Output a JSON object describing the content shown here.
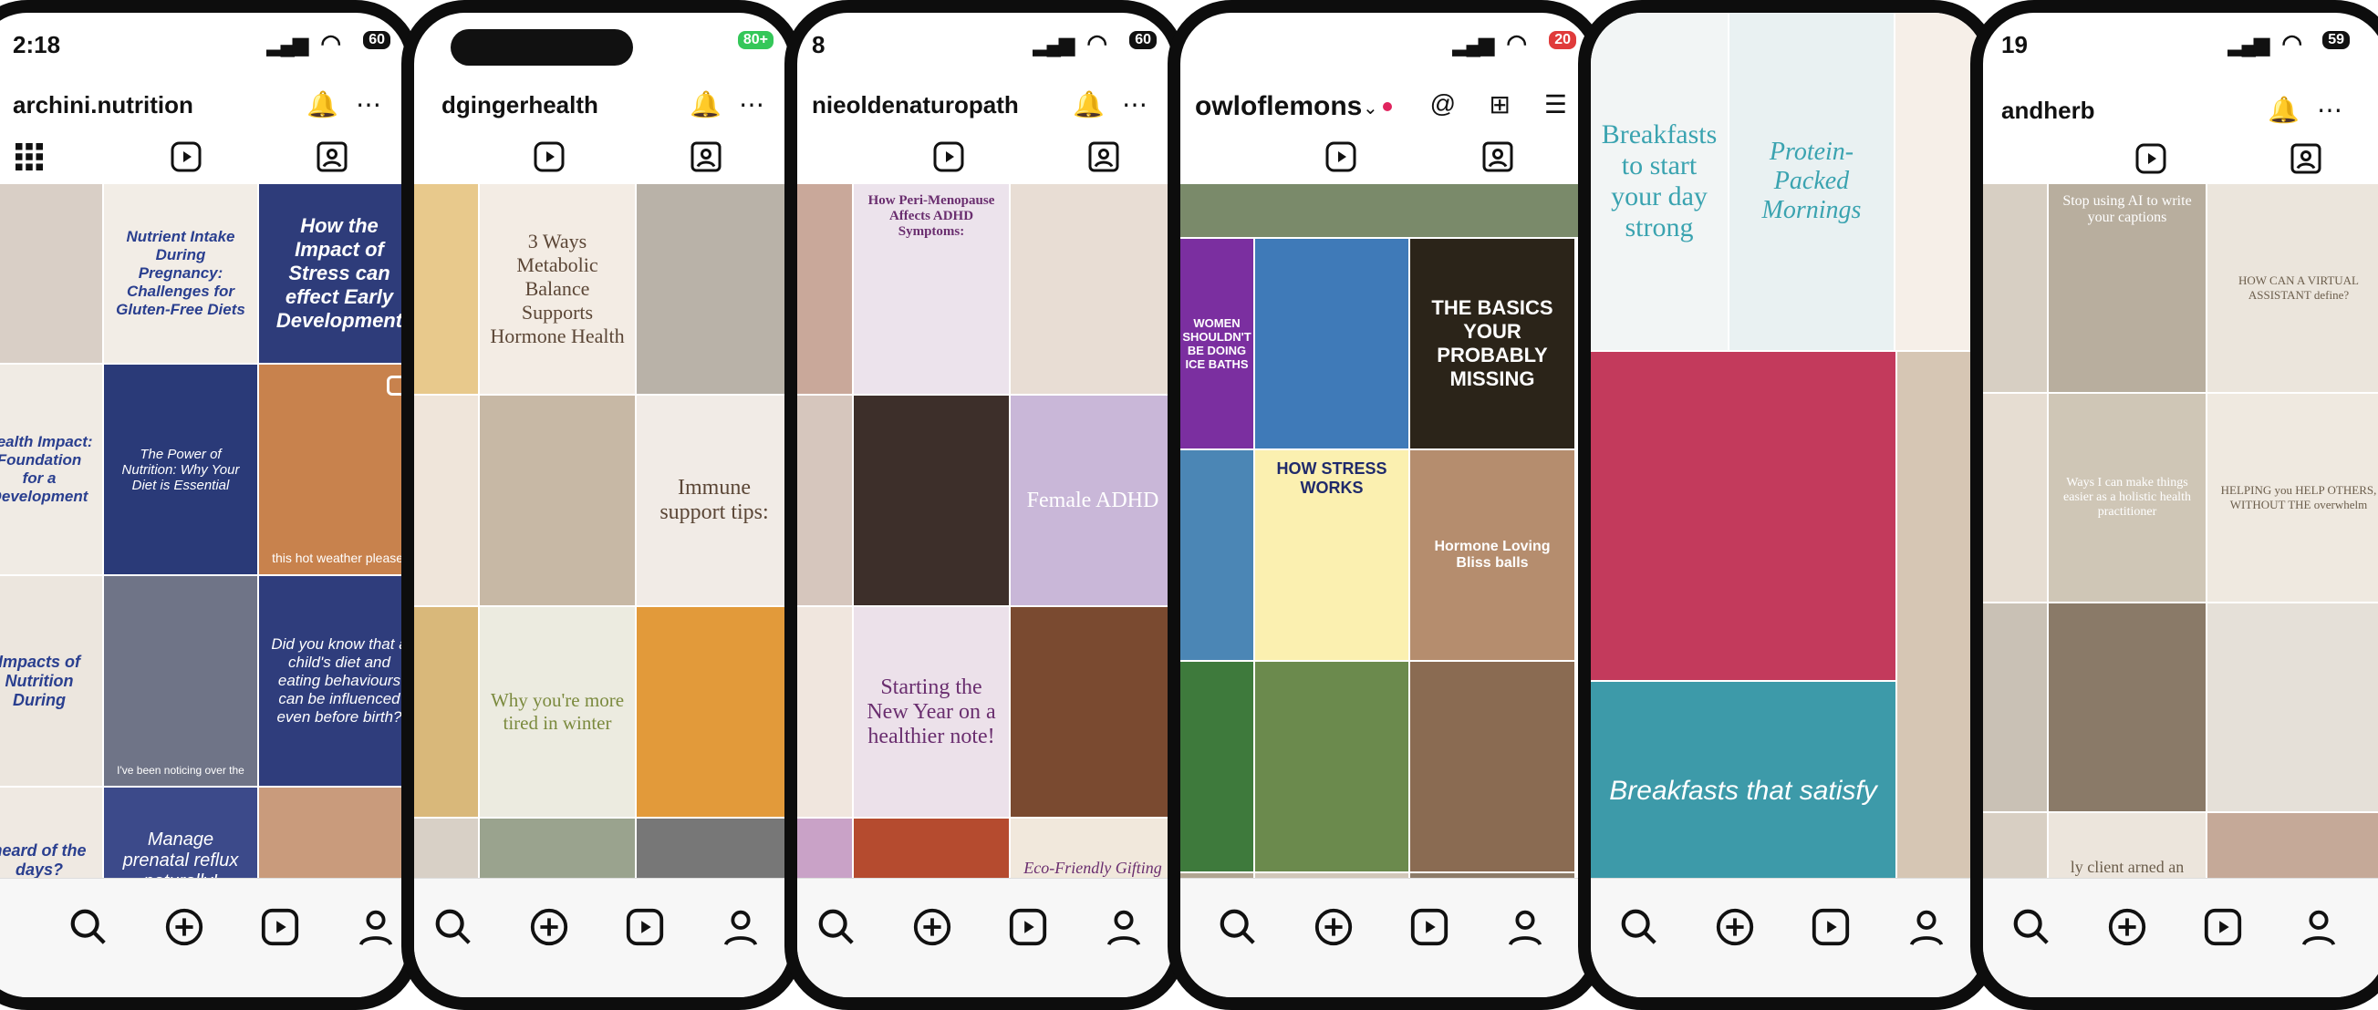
{
  "phones": [
    {
      "time": "2:18",
      "battery": "60",
      "username": "archini.nutrition",
      "tiles": [
        {
          "text": "",
          "bg": "#d9cfc6",
          "color": "#222"
        },
        {
          "text": "Nutrient Intake During Pregnancy: Challenges for Gluten-Free Diets",
          "bg": "#f2ede6",
          "color": "#2a3f8f"
        },
        {
          "text": "How the Impact of Stress can effect Early Development",
          "bg": "#2e3c7a",
          "color": "#ffffff"
        },
        {
          "text": "Health Impact: Foundation for a Development",
          "bg": "#f0ebe4",
          "color": "#2a3f8f"
        },
        {
          "text": "The Power of Nutrition: Why Your Diet is Essential",
          "bg": "#2a3a78",
          "color": "#ffffff"
        },
        {
          "text": "this hot weather please.",
          "bg": "#c8824d",
          "color": "#ffffff"
        },
        {
          "text": "Impacts of Nutrition During",
          "bg": "#ece6de",
          "color": "#2a3f8f"
        },
        {
          "text": "I've been noticing over the",
          "bg": "#6f7487",
          "color": "#ffffff"
        },
        {
          "text": "Did you know that a child's diet and eating behaviours can be influenced even before birth?",
          "bg": "#2f3d7c",
          "color": "#ffffff"
        },
        {
          "text": "heard of the days?",
          "bg": "#efe9e2",
          "color": "#2a3f8f"
        },
        {
          "text": "Manage prenatal reflux naturally!",
          "bg": "#3c4a8a",
          "color": "#ffffff"
        },
        {
          "text": "",
          "bg": "#c99b7c",
          "color": "#fff"
        }
      ]
    },
    {
      "time": "",
      "battery": "80+",
      "username": "dgingerhealth",
      "tiles": [
        {
          "text": "",
          "bg": "#e8c98c",
          "color": "#222"
        },
        {
          "text": "3 Ways Metabolic Balance Supports Hormone Health",
          "bg": "#f3ece4",
          "color": "#5b4636"
        },
        {
          "text": "",
          "bg": "#b9b2a8",
          "color": "#222"
        },
        {
          "text": "",
          "bg": "#efe5da",
          "color": "#222"
        },
        {
          "text": "",
          "bg": "#c7b8a5",
          "color": "#222"
        },
        {
          "text": "Immune support tips:",
          "bg": "#f1ebe6",
          "color": "#5b4636"
        },
        {
          "text": "",
          "bg": "#d9b87a",
          "color": "#222"
        },
        {
          "text": "Why you're more tired in winter",
          "bg": "#ecebe0",
          "color": "#7b8a3e"
        },
        {
          "text": "",
          "bg": "#e29a3a",
          "color": "#222"
        },
        {
          "text": "",
          "bg": "#d8d0c6",
          "color": "#222"
        },
        {
          "text": "",
          "bg": "#9aa38e",
          "color": "#222"
        },
        {
          "text": "",
          "bg": "#777777",
          "color": "#fff"
        }
      ]
    },
    {
      "time": "8",
      "battery": "60",
      "username": "nieoldenaturopath",
      "tiles": [
        {
          "text": "",
          "bg": "#c9a89a",
          "color": "#222"
        },
        {
          "text": "How Peri-Menopause Affects ADHD Symptoms:",
          "bg": "#ece3ec",
          "color": "#6a2e6f"
        },
        {
          "text": "",
          "bg": "#e8ddd4",
          "color": "#222"
        },
        {
          "text": "",
          "bg": "#d6c6bd",
          "color": "#222"
        },
        {
          "text": "",
          "bg": "#3d2f2a",
          "color": "#fff"
        },
        {
          "text": "Female ADHD",
          "bg": "#c9b7d8",
          "color": "#ffffff"
        },
        {
          "text": "",
          "bg": "#f0e6de",
          "color": "#222"
        },
        {
          "text": "Starting the New Year on a healthier note!",
          "bg": "#ece1ea",
          "color": "#6a2e6f"
        },
        {
          "text": "",
          "bg": "#7a4a30",
          "color": "#fff"
        },
        {
          "text": "",
          "bg": "#c9a2c7",
          "color": "#222"
        },
        {
          "text": "",
          "bg": "#b54b2f",
          "color": "#fff"
        },
        {
          "text": "Eco-Friendly Gifting Guide",
          "bg": "#f1e8dc",
          "color": "#6a2e6f"
        }
      ]
    },
    {
      "time": "",
      "battery": "20",
      "username": "owloflemons",
      "tiles": [
        {
          "text": "WOMEN SHOULDN'T BE DOING ICE BATHS",
          "bg": "#7b2fa0",
          "color": "#ffffff"
        },
        {
          "text": "",
          "bg": "#3f7ab8",
          "color": "#fff"
        },
        {
          "text": "THE BASICS YOUR PROBABLY MISSING",
          "bg": "#2b2419",
          "color": "#ffffff"
        },
        {
          "text": "",
          "bg": "#4b86b5",
          "color": "#fff"
        },
        {
          "text": "HOW STRESS WORKS",
          "bg": "#fbf0b0",
          "color": "#1f2a6b"
        },
        {
          "text": "Hormone Loving Bliss balls",
          "bg": "#b58d6e",
          "color": "#ffffff"
        },
        {
          "text": "",
          "bg": "#3e7a3c",
          "color": "#fff"
        },
        {
          "text": "",
          "bg": "#6b8a4d",
          "color": "#fff"
        },
        {
          "text": "",
          "bg": "#8a6b52",
          "color": "#fff"
        },
        {
          "text": "",
          "bg": "#b0a591",
          "color": "#222"
        },
        {
          "text": "",
          "bg": "#d1c7b9",
          "color": "#222"
        },
        {
          "text": "",
          "bg": "#8c7b68",
          "color": "#fff"
        }
      ]
    },
    {
      "time": "",
      "battery": "",
      "username": "",
      "tiles": [
        {
          "text": "Breakfasts to start your day strong",
          "bg": "#f2f5f5",
          "color": "#3aa3b0"
        },
        {
          "text": "Protein-Packed Mornings",
          "bg": "#e9f1f2",
          "color": "#3aa3b0"
        },
        {
          "text": "",
          "bg": "#f6efe8",
          "color": "#222"
        },
        {
          "text": "",
          "bg": "#c33a5c",
          "color": "#fff"
        },
        {
          "text": "Breakfasts that satisfy",
          "bg": "#3d9aa9",
          "color": "#ffffff"
        },
        {
          "text": "",
          "bg": "#d6c6b4",
          "color": "#222"
        }
      ]
    },
    {
      "time": "19",
      "battery": "59",
      "username": "andherb",
      "tiles": [
        {
          "text": "",
          "bg": "#d7cfc3",
          "color": "#222"
        },
        {
          "text": "Stop using AI to write your captions",
          "bg": "#b8ae9e",
          "color": "#ffffff"
        },
        {
          "text": "HOW CAN A VIRTUAL ASSISTANT define?",
          "bg": "#ebe5dc",
          "color": "#6b5d4b"
        },
        {
          "text": "",
          "bg": "#e6ddd2",
          "color": "#222"
        },
        {
          "text": "Ways I can make things easier as a holistic health practitioner",
          "bg": "#cfc6b6",
          "color": "#ffffff"
        },
        {
          "text": "HELPING you HELP OTHERS, WITHOUT THE overwhelm",
          "bg": "#efe9e0",
          "color": "#6b5d4b"
        },
        {
          "text": "",
          "bg": "#c9c1b5",
          "color": "#222"
        },
        {
          "text": "",
          "bg": "#8a7a68",
          "color": "#fff"
        },
        {
          "text": "",
          "bg": "#e5e0d8",
          "color": "#222"
        },
        {
          "text": "ly client arned an extra",
          "bg": "#ece5dc",
          "color": "#6b5d4b"
        },
        {
          "text": "",
          "bg": "#d8cfc3",
          "color": "#222"
        },
        {
          "text": "",
          "bg": "#c5a998",
          "color": "#222"
        }
      ]
    }
  ]
}
